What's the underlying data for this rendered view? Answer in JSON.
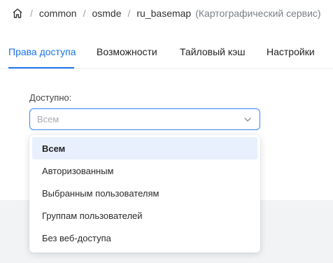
{
  "breadcrumb": {
    "home_icon": "home-icon",
    "separator": "/",
    "items": [
      "common",
      "osmde",
      "ru_basemap"
    ],
    "description": "(Картографический сервис)"
  },
  "tabs": [
    {
      "label": "Права доступа",
      "active": true
    },
    {
      "label": "Возможности",
      "active": false
    },
    {
      "label": "Тайловый кэш",
      "active": false
    },
    {
      "label": "Настройки",
      "active": false
    }
  ],
  "access": {
    "label": "Доступно:",
    "selected_value": "Всем",
    "chevron_icon": "chevron-down-icon",
    "options": [
      {
        "label": "Всем",
        "selected": true
      },
      {
        "label": "Авторизованным",
        "selected": false
      },
      {
        "label": "Выбранным пользователям",
        "selected": false
      },
      {
        "label": "Группам пользователей",
        "selected": false
      },
      {
        "label": "Без веб-доступа",
        "selected": false
      }
    ]
  },
  "colors": {
    "accent": "#1a73e8",
    "selected_bg": "#e8f0fe"
  }
}
